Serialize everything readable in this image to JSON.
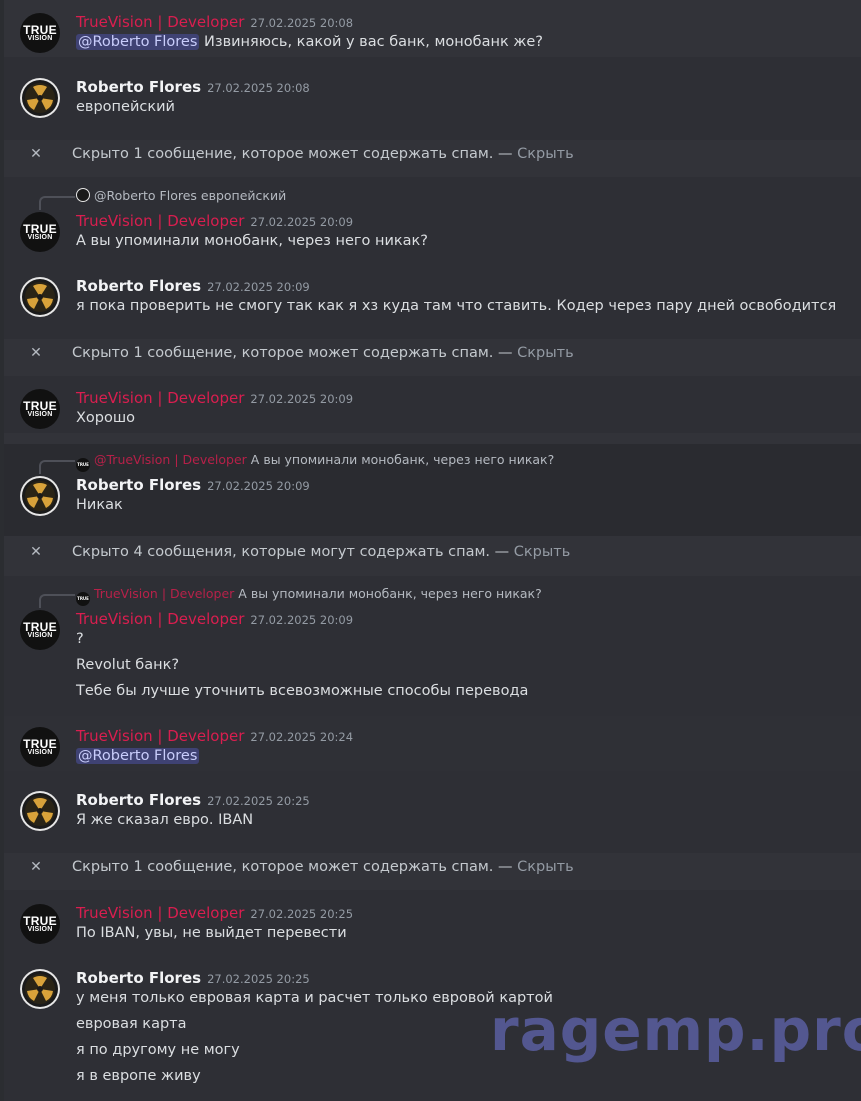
{
  "users": {
    "tv": "TrueVision | Developer",
    "rf": "Roberto Flores"
  },
  "avatar_text": {
    "line1": "TRUE",
    "line2": "VISION"
  },
  "messages": [
    {
      "time": "27.02.2025 20:08",
      "mention": "@Roberto Flores",
      "text": "Извиняюсь, какой у вас банк, монобанк же?"
    },
    {
      "time": "27.02.2025 20:08",
      "text": "европейский"
    },
    {
      "reply_name": "@Roberto Flores",
      "reply_text": "европейский",
      "time": "27.02.2025 20:09",
      "text": "А вы упоминали монобанк, через него никак?"
    },
    {
      "time": "27.02.2025 20:09",
      "text": "я пока проверить не смогу так как я хз куда там что ставить. Кодер через пару дней освободится"
    },
    {
      "time": "27.02.2025 20:09",
      "text": "Хорошо"
    },
    {
      "reply_name": "@TrueVision | Developer",
      "reply_text": "А вы упоминали монобанк, через него никак?",
      "time": "27.02.2025 20:09",
      "text": "Никак"
    },
    {
      "reply_name": "TrueVision | Developer",
      "reply_text": "А вы упоминали монобанк, через него никак?",
      "time": "27.02.2025 20:09",
      "lines": [
        "?",
        "Revolut банк?",
        "Тебе бы лучше уточнить всевозможные способы перевода"
      ]
    },
    {
      "time": "27.02.2025 20:24",
      "mention": "@Roberto Flores"
    },
    {
      "time": "27.02.2025 20:25",
      "text": "Я же сказал евро. IBAN"
    },
    {
      "time": "27.02.2025 20:25",
      "text": "По IBAN, увы, не выйдет перевести"
    },
    {
      "time": "27.02.2025 20:25",
      "lines": [
        "у меня только евровая карта и расчет только евровой картой",
        "евровая карта",
        "я по другому не могу",
        "я в европе живу"
      ]
    }
  ],
  "spam_notices": {
    "one": "Скрыто 1 сообщение, которое может содержать спам. —",
    "four": "Скрыто 4 сообщения, которые могут содержать спам. —",
    "hide": "Скрыть",
    "close_glyph": "✕"
  },
  "watermark": "ragemp.pro",
  "colors": {
    "accent_name": "#d91e4f",
    "mention_bg": "#3f4273",
    "background": "#323339"
  }
}
